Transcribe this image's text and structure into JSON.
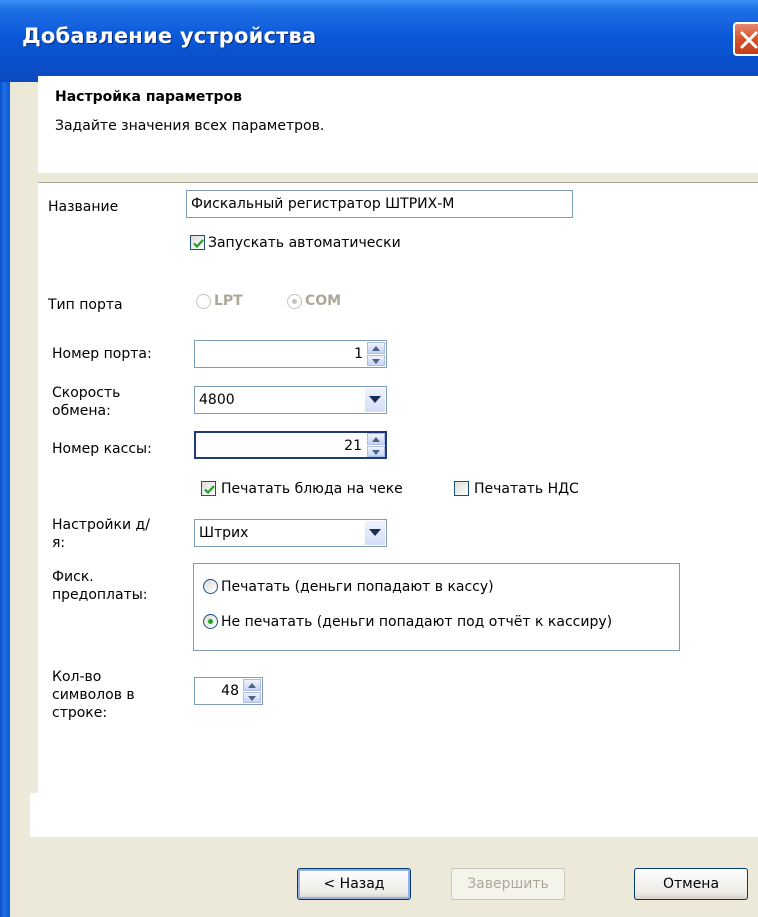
{
  "window": {
    "title": "Добавление устройства"
  },
  "header": {
    "title": "Настройка параметров",
    "subtitle": "Задайте значения всех параметров."
  },
  "form": {
    "name_label": "Название",
    "name_value": "Фискальный регистратор ШТРИХ-М",
    "autostart_label": "Запускать автоматически",
    "autostart_checked": true,
    "port_type_label": "Тип порта",
    "port_type_options": [
      "LPT",
      "COM"
    ],
    "port_type_selected": "COM",
    "port_number_label": "Номер порта:",
    "port_number_value": "1",
    "baud_label": "Скорость обмена:",
    "baud_value": "4800",
    "register_label": "Номер кассы:",
    "register_value": "21",
    "print_dishes_label": "Печатать блюда на чеке",
    "print_dishes_checked": true,
    "print_vat_label": "Печатать НДС",
    "print_vat_checked": false,
    "settings_dy_label": "Настройки д/я:",
    "settings_dy_value": "Штрих",
    "fisc_label": "Фиск. предоплаты:",
    "fisc_options": [
      "Печатать (деньги попадают в кассу)",
      "Не печатать (деньги попадают под отчёт к кассиру)"
    ],
    "fisc_selected": 1,
    "chars_label": "Кол-во символов в строке:",
    "chars_value": "48"
  },
  "buttons": {
    "back": "< Назад",
    "finish": "Завершить",
    "cancel": "Отмена"
  },
  "colors": {
    "titlebar": "#0b58d8",
    "check_green": "#21a121",
    "close_red": "#d4532c"
  }
}
